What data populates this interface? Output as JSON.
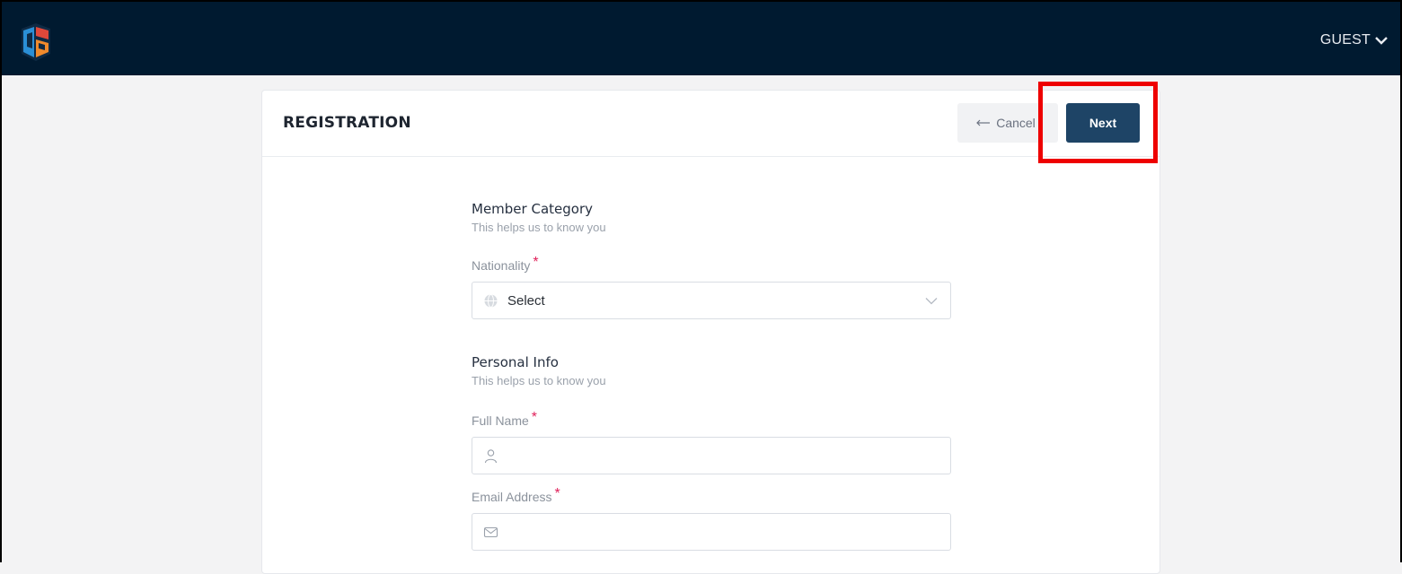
{
  "header": {
    "user_label": "GUEST"
  },
  "registration": {
    "title": "REGISTRATION",
    "cancel_label": "Cancel",
    "next_label": "Next"
  },
  "member_category": {
    "title": "Member Category",
    "subtitle": "This helps us to know you",
    "nationality": {
      "label": "Nationality",
      "required_mark": "*",
      "value": "Select"
    }
  },
  "personal_info": {
    "title": "Personal Info",
    "subtitle": "This helps us to know you",
    "full_name": {
      "label": "Full Name",
      "required_mark": "*",
      "value": ""
    },
    "email": {
      "label": "Email Address",
      "required_mark": "*",
      "value": ""
    }
  },
  "colors": {
    "topbar": "#001a30",
    "primary_button": "#1e4466",
    "required": "#e0215a",
    "highlight": "#ee0000"
  },
  "icons": [
    "app-logo",
    "chevron-down-icon",
    "arrow-left-icon",
    "globe-icon",
    "user-icon",
    "mail-icon"
  ]
}
